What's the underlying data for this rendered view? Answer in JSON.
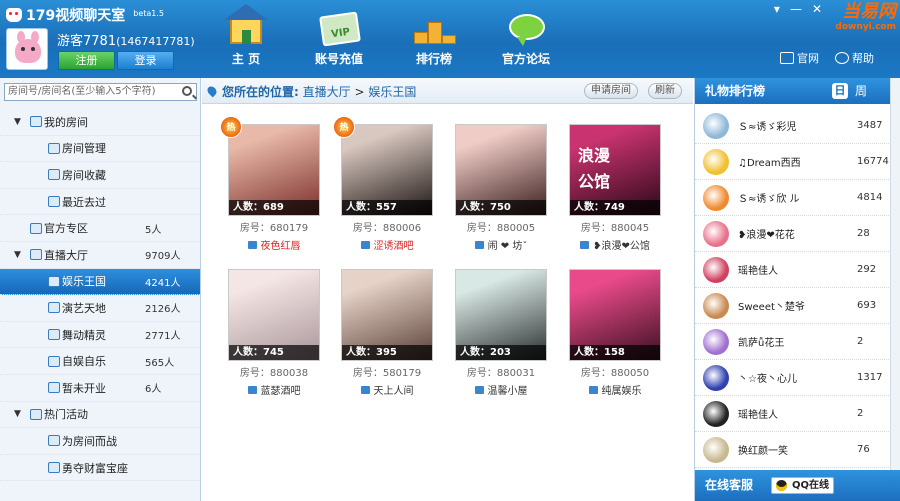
{
  "header": {
    "app_title": "179视频聊天室",
    "beta": "beta1.5",
    "username": "游客7781",
    "user_id": "(1467417781)",
    "register_label": "注册",
    "login_label": "登录",
    "nav": [
      {
        "label": "主 页",
        "icon": "home-icon"
      },
      {
        "label": "账号充值",
        "icon": "vip-card-icon"
      },
      {
        "label": "排行榜",
        "icon": "podium-icon"
      },
      {
        "label": "官方论坛",
        "icon": "chat-bubble-icon"
      }
    ],
    "site_label": "官网",
    "help_label": "帮助",
    "watermark_main": "当易网",
    "watermark_sub": "downyi.com"
  },
  "sidebar": {
    "search_placeholder": "房间号/房间名(至少输入5个字符)",
    "tree": [
      {
        "label": "我的房间",
        "count": "",
        "level": 0,
        "arrow": true
      },
      {
        "label": "房间管理",
        "count": "",
        "level": 1
      },
      {
        "label": "房间收藏",
        "count": "",
        "level": 1
      },
      {
        "label": "最近去过",
        "count": "",
        "level": 1
      },
      {
        "label": "官方专区",
        "count": "5人",
        "level": 0
      },
      {
        "label": "直播大厅",
        "count": "9709人",
        "level": 0,
        "arrow": true
      },
      {
        "label": "娱乐王国",
        "count": "4241人",
        "level": 1,
        "selected": true
      },
      {
        "label": "演艺天地",
        "count": "2126人",
        "level": 1
      },
      {
        "label": "舞动精灵",
        "count": "2771人",
        "level": 1
      },
      {
        "label": "自娱自乐",
        "count": "565人",
        "level": 1
      },
      {
        "label": "暂未开业",
        "count": "6人",
        "level": 1
      },
      {
        "label": "热门活动",
        "count": "",
        "level": 0,
        "arrow": true
      },
      {
        "label": "为房间而战",
        "count": "",
        "level": 1
      },
      {
        "label": "勇夺财富宝座",
        "count": "",
        "level": 1
      }
    ]
  },
  "main": {
    "location_label": "您所在的位置:",
    "breadcrumb_parent": "直播大厅",
    "breadcrumb_sep": ">",
    "breadcrumb_current": "娱乐王国",
    "apply_room_label": "申请房间",
    "refresh_label": "刷新",
    "rooms": [
      {
        "count": "人数：689",
        "room_no": "房号：680179",
        "name": "夜色红唇",
        "hot": true,
        "red": true,
        "color1": "#e8b8a8",
        "color2": "#7a2f2a"
      },
      {
        "count": "人数：557",
        "room_no": "房号：880006",
        "name": "涩诱酒吧",
        "hot": true,
        "red": true,
        "color1": "#d9c8c0",
        "color2": "#1c1412"
      },
      {
        "count": "人数：750",
        "room_no": "房号：880005",
        "name": "闹 ❤ 坊ˇ",
        "hot": false,
        "red": false,
        "color1": "#f0ccc6",
        "color2": "#3a1e1e"
      },
      {
        "count": "人数：749",
        "room_no": "房号：880045",
        "name": "❥浪漫❤公馆",
        "hot": false,
        "red": false,
        "color1": "#c9336f",
        "color2": "#2a0818"
      },
      {
        "count": "人数：745",
        "room_no": "房号：880038",
        "name": "蓝瑟酒吧",
        "hot": false,
        "red": false,
        "color1": "#f4e6e4",
        "color2": "#a9959a"
      },
      {
        "count": "人数：395",
        "room_no": "房号：580179",
        "name": "天上人间",
        "hot": false,
        "red": false,
        "color1": "#e6d2c6",
        "color2": "#5a4038"
      },
      {
        "count": "人数：203",
        "room_no": "房号：880031",
        "name": "温馨小屋",
        "hot": false,
        "red": false,
        "color1": "#d8e8e4",
        "color2": "#2a2e30"
      },
      {
        "count": "人数：158",
        "room_no": "房号：880050",
        "name": "纯属娱乐",
        "hot": false,
        "red": false,
        "color1": "#e94a8a",
        "color2": "#3a1020"
      }
    ],
    "hot_badge": "热",
    "screen_text": "浪漫公馆"
  },
  "ranking": {
    "title": "礼物排行榜",
    "day_label": "日",
    "week_label": "周",
    "items": [
      {
        "name": "Ｓ≈诱ゞ彩児",
        "value": "3487",
        "color": "#8fb7d9"
      },
      {
        "name": "♫Dream西西",
        "value": "16774",
        "color": "#f0c030"
      },
      {
        "name": "Ｓ≈诱ゞ欣 ル",
        "value": "4814",
        "color": "#f08a30"
      },
      {
        "name": "❥浪漫❤花花",
        "value": "28",
        "color": "#e9708a"
      },
      {
        "name": "瑶艳佳人",
        "value": "292",
        "color": "#d04060"
      },
      {
        "name": "Sweeet丶楚爷",
        "value": "693",
        "color": "#c88a50"
      },
      {
        "name": "凯萨ǚ花王",
        "value": "2",
        "color": "#a070d0"
      },
      {
        "name": "丶☆夜丶心儿",
        "value": "1317",
        "color": "#3040b0"
      },
      {
        "name": "瑶艳佳人",
        "value": "2",
        "color": "#222222"
      },
      {
        "name": "换红颜一笑",
        "value": "76",
        "color": "#c8b890"
      }
    ],
    "service_label": "在线客服",
    "qq_label": "QQ在线"
  }
}
